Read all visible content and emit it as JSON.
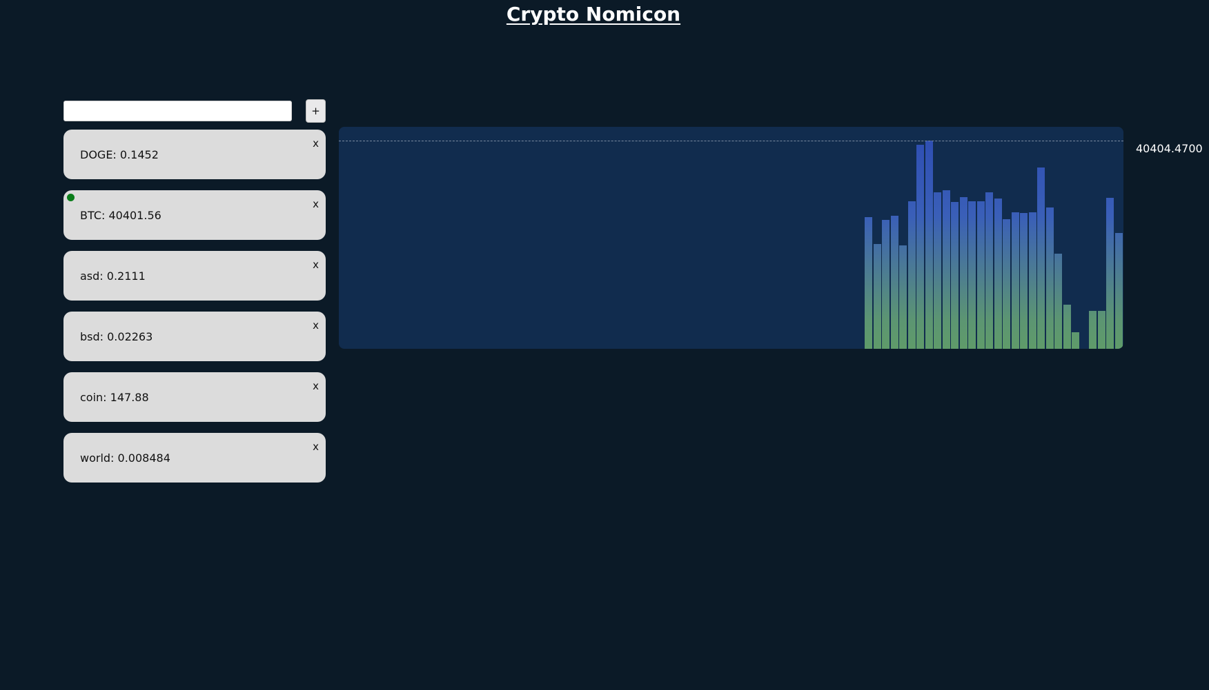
{
  "app": {
    "title": "Crypto Nomicon"
  },
  "add": {
    "input_value": "",
    "input_placeholder": "",
    "button_label": "+"
  },
  "tickers": [
    {
      "label": "DOGE: 0.1452",
      "close": "x",
      "active": false
    },
    {
      "label": "BTC: 40401.56",
      "close": "x",
      "active": true
    },
    {
      "label": "asd: 0.2111",
      "close": "x",
      "active": false
    },
    {
      "label": "bsd: 0.02263",
      "close": "x",
      "active": false
    },
    {
      "label": "coin: 147.88",
      "close": "x",
      "active": false
    },
    {
      "label": "world: 0.008484",
      "close": "x",
      "active": false
    }
  ],
  "colors": {
    "background": "#0b1a27",
    "graph_bg": "#112c4e",
    "card_bg": "#dcdcdc",
    "active_dot": "#0a7d1a",
    "bar_top": "#2f4fb3",
    "bar_bottom": "#5f9b6a"
  },
  "graph": {
    "max_value_label": "40404.4700",
    "max_value": 40404.47,
    "slots": 91,
    "bars": [
      {
        "slot": 61,
        "level": 0.632
      },
      {
        "slot": 62,
        "level": 0.502
      },
      {
        "slot": 63,
        "level": 0.62
      },
      {
        "slot": 64,
        "level": 0.64
      },
      {
        "slot": 65,
        "level": 0.496
      },
      {
        "slot": 66,
        "level": 0.71
      },
      {
        "slot": 67,
        "level": 0.98
      },
      {
        "slot": 68,
        "level": 1.0
      },
      {
        "slot": 69,
        "level": 0.75
      },
      {
        "slot": 70,
        "level": 0.762
      },
      {
        "slot": 71,
        "level": 0.706
      },
      {
        "slot": 72,
        "level": 0.73
      },
      {
        "slot": 73,
        "level": 0.708
      },
      {
        "slot": 74,
        "level": 0.71
      },
      {
        "slot": 75,
        "level": 0.752
      },
      {
        "slot": 76,
        "level": 0.722
      },
      {
        "slot": 77,
        "level": 0.622
      },
      {
        "slot": 78,
        "level": 0.656
      },
      {
        "slot": 79,
        "level": 0.652
      },
      {
        "slot": 80,
        "level": 0.654
      },
      {
        "slot": 81,
        "level": 0.87
      },
      {
        "slot": 82,
        "level": 0.68
      },
      {
        "slot": 83,
        "level": 0.456
      },
      {
        "slot": 84,
        "level": 0.212
      },
      {
        "slot": 85,
        "level": 0.08
      },
      {
        "slot": 87,
        "level": 0.182
      },
      {
        "slot": 88,
        "level": 0.182
      },
      {
        "slot": 89,
        "level": 0.726
      },
      {
        "slot": 90,
        "level": 0.556
      }
    ]
  }
}
